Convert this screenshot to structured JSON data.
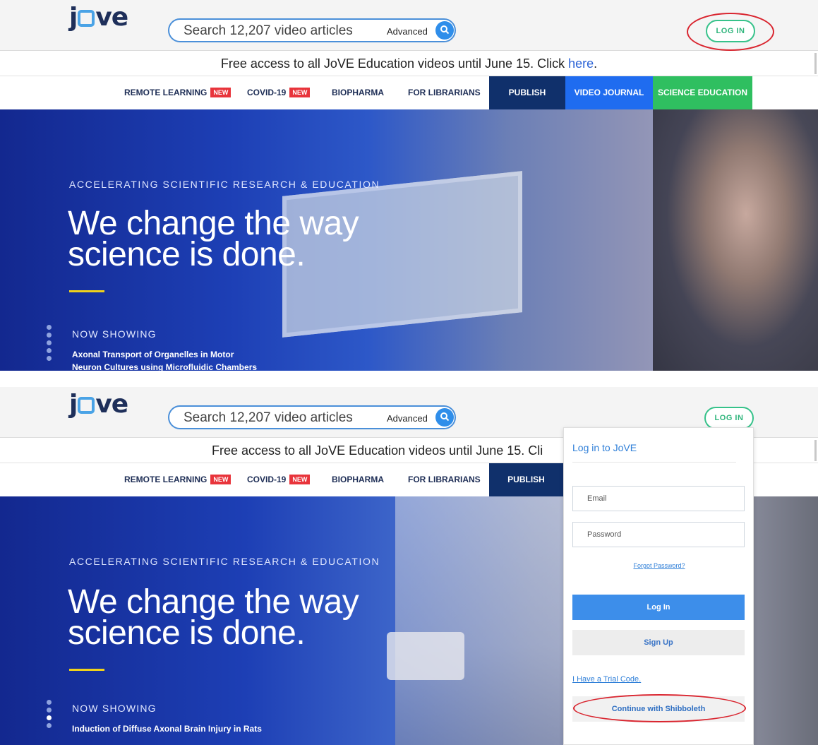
{
  "header": {
    "logo_text_a": "j",
    "logo_text_b": "ve",
    "search_placeholder": "Search 12,207 video articles",
    "advanced_label": "Advanced",
    "login_label": "LOG IN"
  },
  "banner": {
    "text": "Free access to all JoVE Education videos until June 15. Click ",
    "link": "here",
    "suffix": ".",
    "text_truncated": "Free access to all JoVE Education videos until June 15. Cli"
  },
  "nav": {
    "remote_learning": "REMOTE LEARNING",
    "covid": "COVID-19",
    "new_badge": "NEW",
    "biopharma": "BIOPHARMA",
    "librarians": "FOR LIBRARIANS",
    "publish": "PUBLISH",
    "video_journal": "VIDEO JOURNAL",
    "science_education": "SCIENCE EDUCATION"
  },
  "hero": {
    "kicker": "ACCELERATING SCIENTIFIC RESEARCH & EDUCATION",
    "headline_1": "We change the way",
    "headline_2": "science is done.",
    "now_showing": "NOW SHOWING",
    "shot1_title_1": "Axonal Transport of Organelles in Motor",
    "shot1_title_2": "Neuron Cultures using Microfluidic Chambers",
    "shot2_title_1": "Induction of Diffuse Axonal Brain Injury in Rats"
  },
  "login_panel": {
    "title": "Log in to JoVE",
    "email_placeholder": "Email",
    "password_placeholder": "Password",
    "forgot": "Forgot Password?",
    "login_button": "Log In",
    "signup_button": "Sign Up",
    "trial_code": "I Have a Trial Code.",
    "shibboleth": "Continue with Shibboleth"
  },
  "colors": {
    "brand_navy": "#1e2f5a",
    "accent_blue": "#2f8eea",
    "login_green": "#36c28a",
    "highlight_red": "#d9252f",
    "publish_bg": "#10306b",
    "video_journal_bg": "#1f6cf0",
    "science_education_bg": "#2fbf60",
    "hero_yellow": "#f0d21b"
  }
}
